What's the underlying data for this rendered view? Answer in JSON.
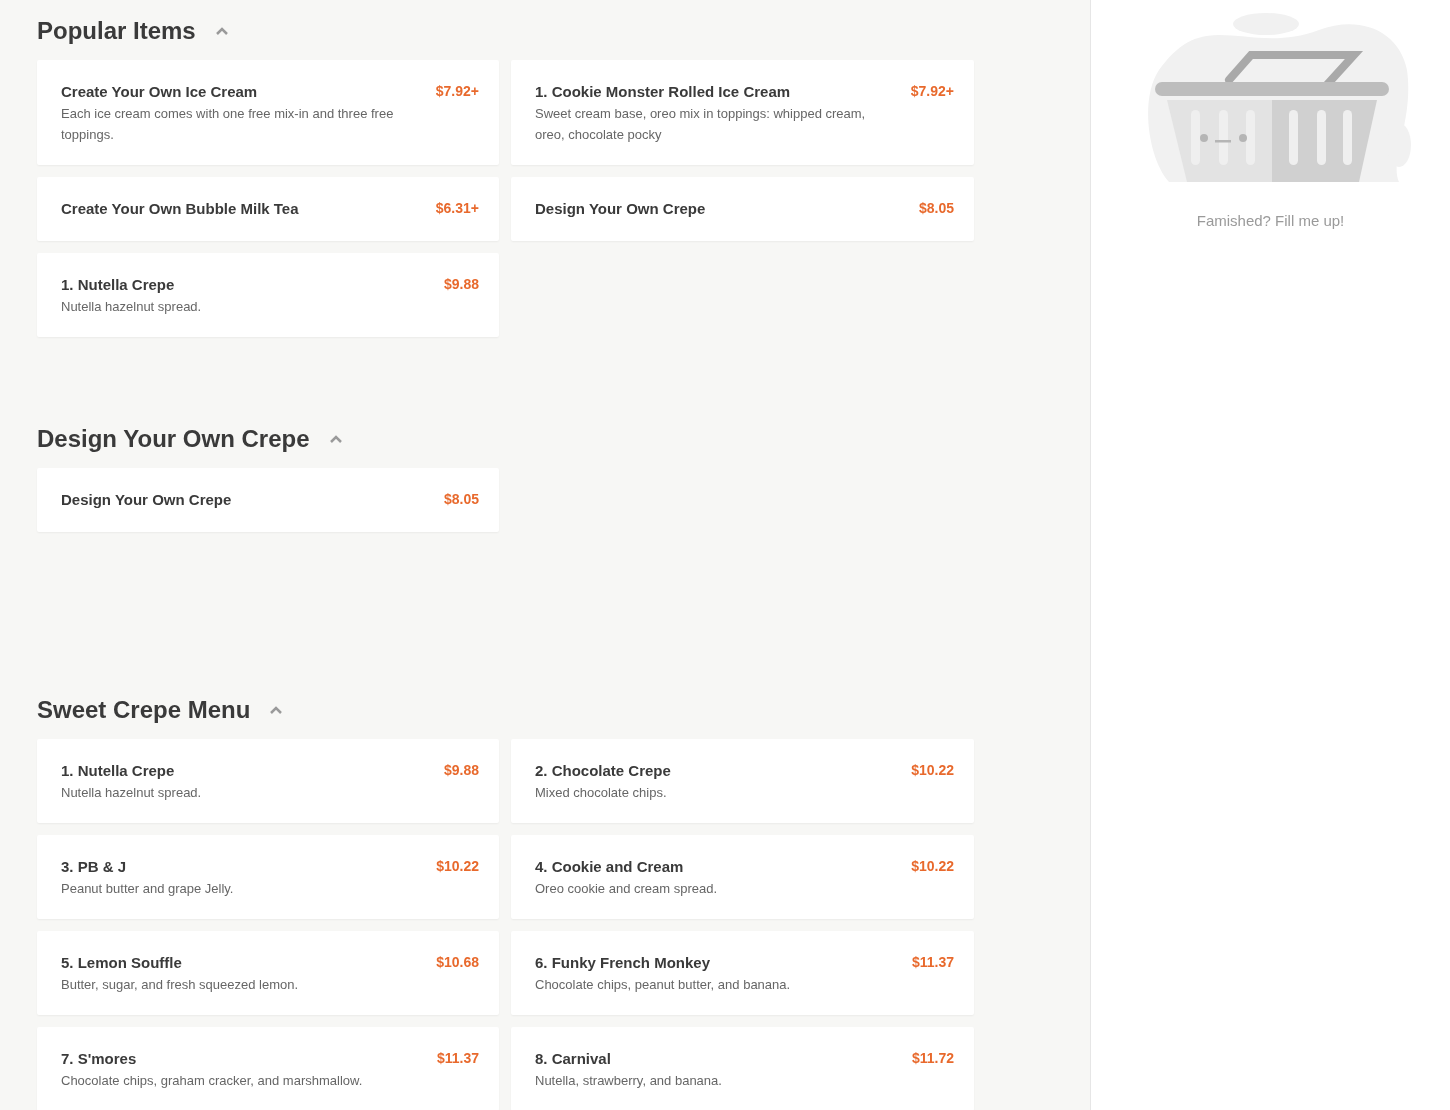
{
  "sections": [
    {
      "title": "Popular Items",
      "expanded": true,
      "items": [
        {
          "name": "Create Your Own Ice Cream",
          "price": "$7.92+",
          "description": "Each ice cream comes with one free mix-in and three free toppings."
        },
        {
          "name": "1. Cookie Monster Rolled Ice Cream",
          "price": "$7.92+",
          "description": "Sweet cream base, oreo mix in toppings: whipped cream, oreo, chocolate pocky"
        },
        {
          "name": "Create Your Own Bubble Milk Tea",
          "price": "$6.31+"
        },
        {
          "name": "Design Your Own Crepe",
          "price": "$8.05"
        },
        {
          "name": "1. Nutella Crepe",
          "price": "$9.88",
          "description": "Nutella hazelnut spread."
        }
      ]
    },
    {
      "title": "Design Your Own Crepe",
      "expanded": true,
      "items": [
        {
          "name": "Design Your Own Crepe",
          "price": "$8.05"
        }
      ]
    },
    {
      "title": "Sweet Crepe Menu",
      "expanded": true,
      "items": [
        {
          "name": "1. Nutella Crepe",
          "price": "$9.88",
          "description": "Nutella hazelnut spread."
        },
        {
          "name": "2. Chocolate Crepe",
          "price": "$10.22",
          "description": "Mixed chocolate chips."
        },
        {
          "name": "3. PB & J",
          "price": "$10.22",
          "description": "Peanut butter and grape Jelly."
        },
        {
          "name": "4. Cookie and Cream",
          "price": "$10.22",
          "description": "Oreo cookie and cream spread."
        },
        {
          "name": "5. Lemon Souffle",
          "price": "$10.68",
          "description": "Butter, sugar, and fresh squeezed lemon."
        },
        {
          "name": "6. Funky French Monkey",
          "price": "$11.37",
          "description": "Chocolate chips, peanut butter, and banana."
        },
        {
          "name": "7. S'mores",
          "price": "$11.37",
          "description": "Chocolate chips, graham cracker, and marshmallow."
        },
        {
          "name": "8. Carnival",
          "price": "$11.72",
          "description": "Nutella, strawberry, and banana."
        }
      ]
    }
  ],
  "cart": {
    "empty_message": "Famished? Fill me up!"
  }
}
